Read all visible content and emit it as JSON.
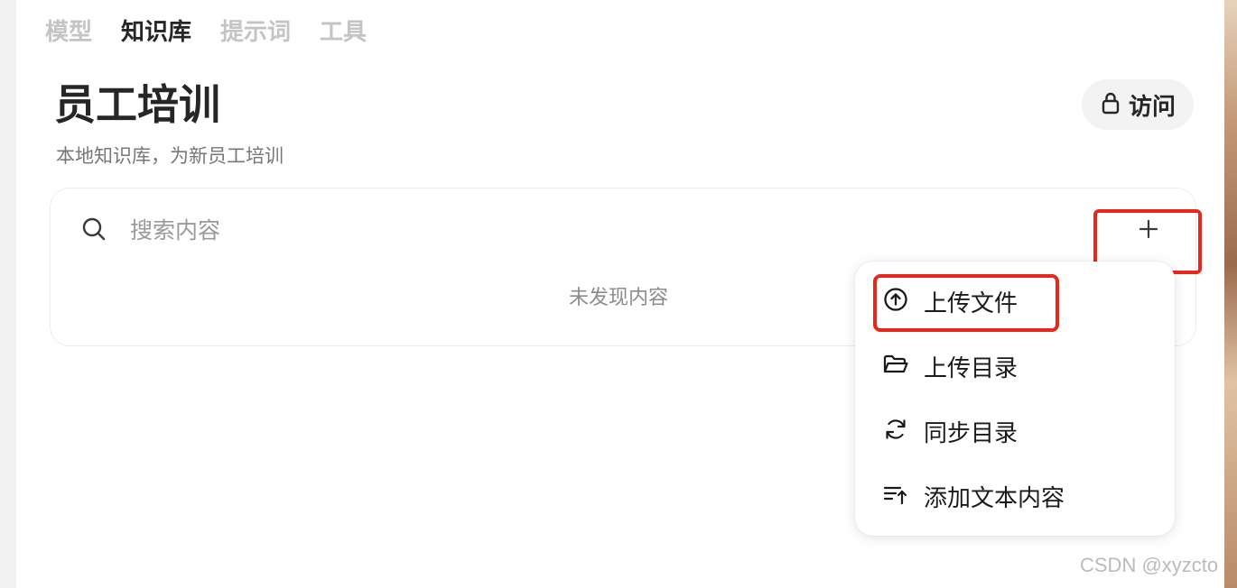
{
  "nav": {
    "tabs": [
      {
        "label": "模型",
        "active": false
      },
      {
        "label": "知识库",
        "active": true
      },
      {
        "label": "提示词",
        "active": false
      },
      {
        "label": "工具",
        "active": false
      }
    ]
  },
  "header": {
    "title": "员工培训",
    "subtitle": "本地知识库，为新员工培训",
    "access_label": "访问",
    "access_icon": "lock-icon"
  },
  "search": {
    "placeholder": "搜索内容",
    "value": "",
    "icon": "search-icon"
  },
  "content": {
    "empty_text": "未发现内容"
  },
  "add_button": {
    "icon": "plus-icon"
  },
  "menu": {
    "items": [
      {
        "label": "上传文件",
        "icon": "upload-circle-icon"
      },
      {
        "label": "上传目录",
        "icon": "folder-open-icon"
      },
      {
        "label": "同步目录",
        "icon": "sync-icon"
      },
      {
        "label": "添加文本内容",
        "icon": "add-text-icon"
      }
    ]
  },
  "watermark": "CSDN @xyzcto",
  "colors": {
    "highlight": "#e8281c",
    "active_tab": "#262626",
    "inactive_tab": "#c4c4c4"
  }
}
